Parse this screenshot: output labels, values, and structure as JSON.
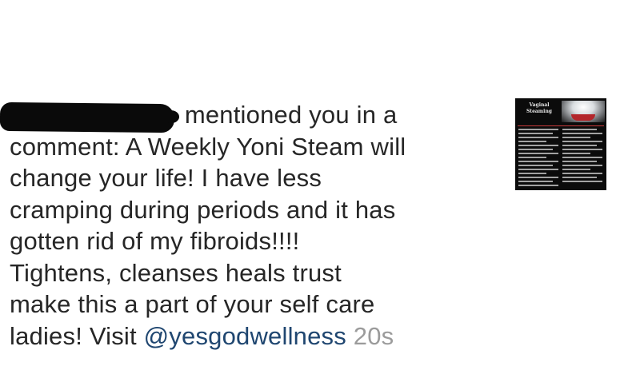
{
  "notification": {
    "comment_lines": [
      "mentioned you in a",
      "comment: A Weekly Yoni Steam will",
      "change your life! I have less",
      "cramping during periods and it has",
      "gotten rid of my fibroids!!!!",
      "Tightens, cleanses heals trust",
      "make this a part of your self care",
      "ladies! Visit "
    ],
    "mention_handle": "@yesgodwellness",
    "timestamp": "20s",
    "thumbnail": {
      "title": "Vaginal Steaming"
    }
  },
  "colors": {
    "text": "#262626",
    "mention": "#1f4670",
    "timestamp": "#9b9b9b",
    "redaction": "#0a0a0a"
  }
}
